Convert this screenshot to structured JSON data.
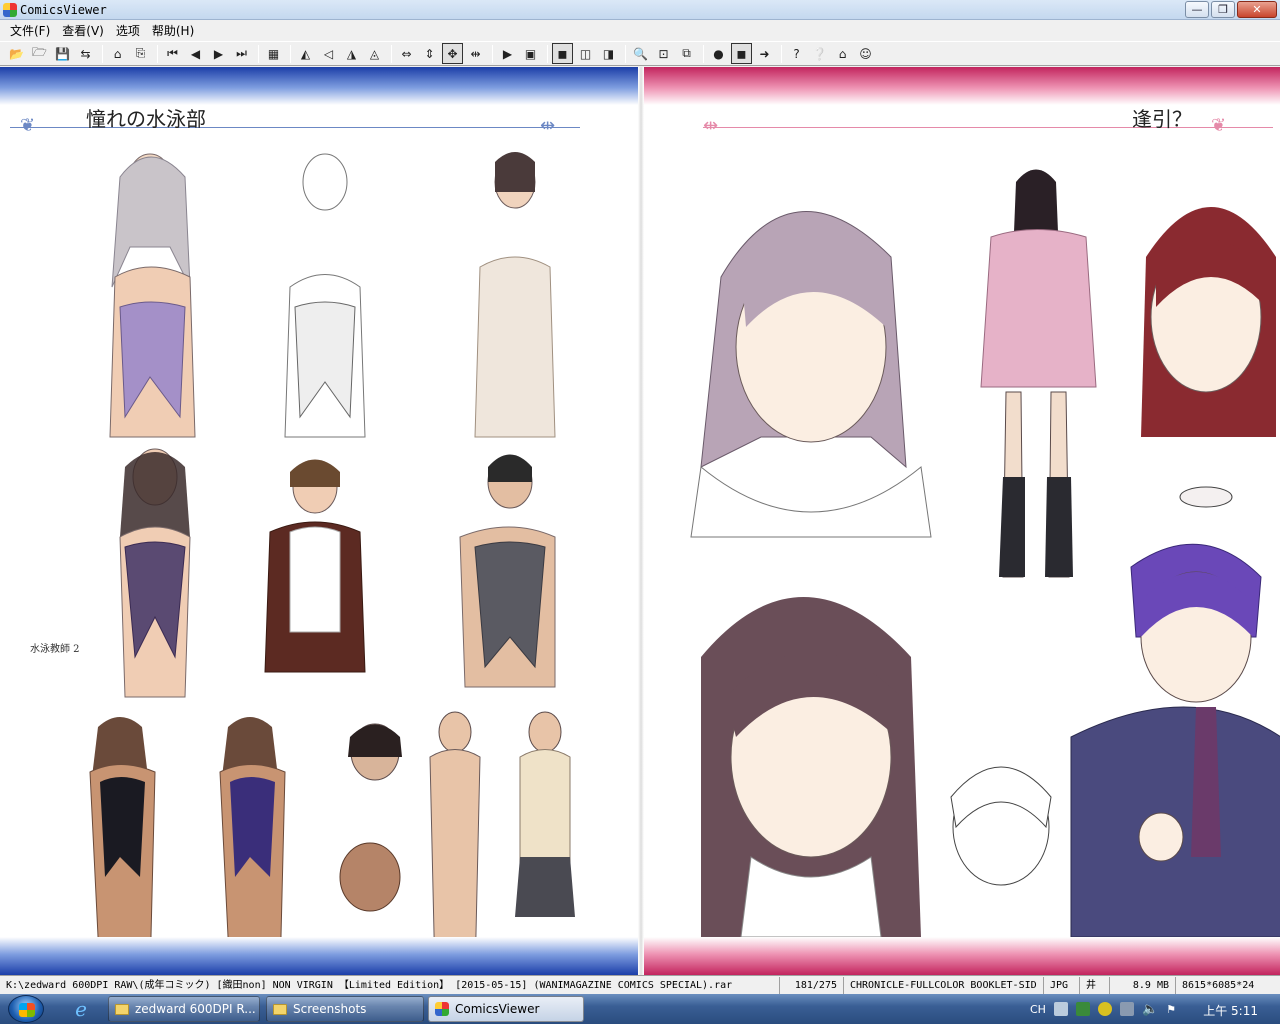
{
  "window": {
    "title": "ComicsViewer",
    "buttons": {
      "minimize": "—",
      "maximize": "❐",
      "close": "✕"
    }
  },
  "menu": [
    "文件(F)",
    "查看(V)",
    "选项",
    "帮助(H)"
  ],
  "toolbar": {
    "groups": [
      [
        "open-folder-icon",
        "open-file-icon",
        "save-icon",
        "export-icon"
      ],
      [
        "bookmark-icon",
        "recent-icon"
      ],
      [
        "first-page-icon",
        "prev-page-icon",
        "next-page-icon",
        "last-page-icon"
      ],
      [
        "thumbnails-icon"
      ],
      [
        "flip-horizontal-icon",
        "rotate-left-icon",
        "rotate-right-icon",
        "flip-vertical-icon"
      ],
      [
        "fit-width-icon",
        "fit-height-icon",
        "spread-icon",
        "single-page-icon"
      ],
      [
        "slideshow-icon",
        "fullscreen-icon"
      ],
      [
        "view-mode-1-icon",
        "view-mode-2-icon",
        "view-mode-3-icon"
      ],
      [
        "zoom-in-icon",
        "zoom-window-icon",
        "zoom-copy-icon"
      ],
      [
        "color-icon",
        "filter-icon",
        "arrow-icon"
      ],
      [
        "help-icon",
        "question-icon",
        "home-icon",
        "about-icon"
      ]
    ],
    "glyphs": {
      "open-folder-icon": "📂",
      "open-file-icon": "🗁",
      "save-icon": "💾",
      "export-icon": "⇆",
      "bookmark-icon": "⌂",
      "recent-icon": "⎘",
      "first-page-icon": "⏮",
      "prev-page-icon": "◀",
      "next-page-icon": "▶",
      "last-page-icon": "⏭",
      "thumbnails-icon": "▦",
      "flip-horizontal-icon": "◭",
      "rotate-left-icon": "◁",
      "rotate-right-icon": "◮",
      "flip-vertical-icon": "◬",
      "fit-width-icon": "⇔",
      "fit-height-icon": "⇕",
      "spread-icon": "✥",
      "single-page-icon": "⇹",
      "slideshow-icon": "▶",
      "fullscreen-icon": "▣",
      "view-mode-1-icon": "◼",
      "view-mode-2-icon": "◫",
      "view-mode-3-icon": "◨",
      "zoom-in-icon": "🔍",
      "zoom-window-icon": "⊡",
      "zoom-copy-icon": "⧉",
      "color-icon": "●",
      "filter-icon": "◼",
      "arrow-icon": "➜",
      "help-icon": "?",
      "question-icon": "❔",
      "home-icon": "⌂",
      "about-icon": "☺"
    },
    "active": [
      "view-mode-1-icon",
      "spread-icon",
      "filter-icon"
    ]
  },
  "page": {
    "left_heading": "憧れの水泳部",
    "right_heading": "逢引？",
    "sketch_caption": "水泳教師 2",
    "accent_left": "#1b3ea8",
    "accent_right": "#c2245e"
  },
  "status": {
    "path": "K:\\zedward 600DPI RAW\\(成年コミック) [織田non] NON VIRGIN 【Limited Edition】 [2015-05-15] (WANIMAGAZINE COMICS SPECIAL).rar",
    "page_index": "181/275",
    "file_name": "CHRONICLE-FULLCOLOR BOOKLET-SID",
    "format": "JPG",
    "flag": "井",
    "size": "8.9 MB",
    "dimensions": "8615*6085*24"
  },
  "taskbar": {
    "tasks": [
      {
        "label": "zedward 600DPI R...",
        "icon": "folder-icon",
        "active": false
      },
      {
        "label": "Screenshots",
        "icon": "folder-icon",
        "active": false
      },
      {
        "label": "ComicsViewer",
        "icon": "comicsviewer-icon",
        "active": true
      }
    ],
    "tray_lang": "CH",
    "clock": "上午 5:11"
  }
}
